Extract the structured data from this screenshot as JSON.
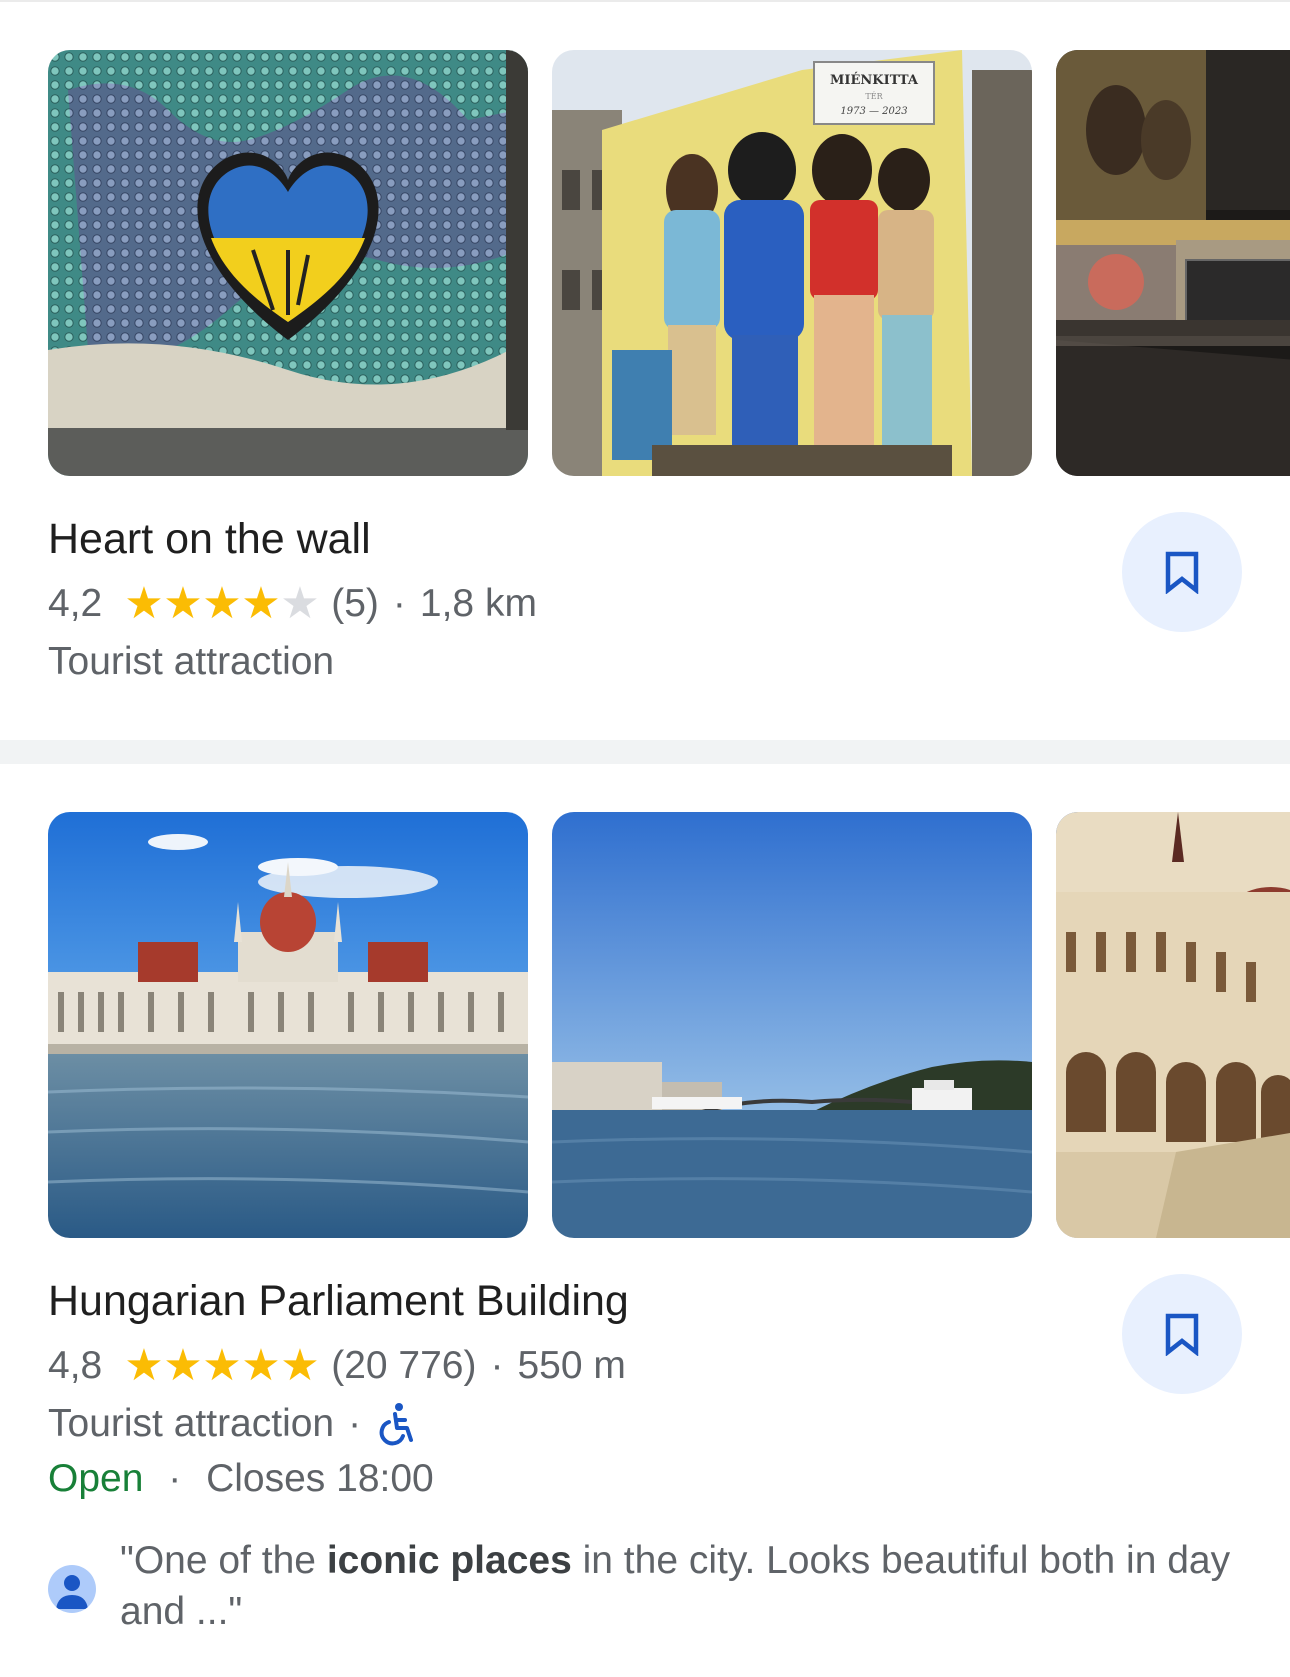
{
  "places": [
    {
      "name": "Heart on the wall",
      "rating": "4,2",
      "stars_filled": 4,
      "stars_total": 5,
      "reviews": "(5)",
      "distance_sep": "·",
      "distance": "1,8 km",
      "category": "Tourist attraction",
      "photos": [
        "graffiti heart mural",
        "Mienkitta street mural",
        "street at night"
      ]
    },
    {
      "name": "Hungarian Parliament Building",
      "rating": "4,8",
      "stars_filled": 5,
      "stars_total": 5,
      "reviews": "(20 776)",
      "distance_sep": "·",
      "distance": "550 m",
      "category": "Tourist attraction",
      "category_sep": "·",
      "accessibility_icon": "wheelchair-icon",
      "open_status": "Open",
      "hours_sep": "·",
      "closes": "Closes 18:00",
      "review": {
        "prefix": "\"One of the ",
        "highlight": "iconic places",
        "suffix": " in the city. Looks beautiful both in day and ...\""
      },
      "photos": [
        "parliament across river",
        "Danube river view",
        "parliament facade"
      ]
    }
  ],
  "mural_sign": {
    "line1": "MIÉNKITTA",
    "line2": "TÉR",
    "line3": "1973 — 2023"
  },
  "colors": {
    "star": "#fbbc04",
    "open": "#188038",
    "accent": "#1a56c4",
    "bookmark_bg": "#e8f0fe"
  },
  "icons": {
    "bookmark": "bookmark-icon",
    "star": "star-icon",
    "avatar": "person-icon"
  }
}
